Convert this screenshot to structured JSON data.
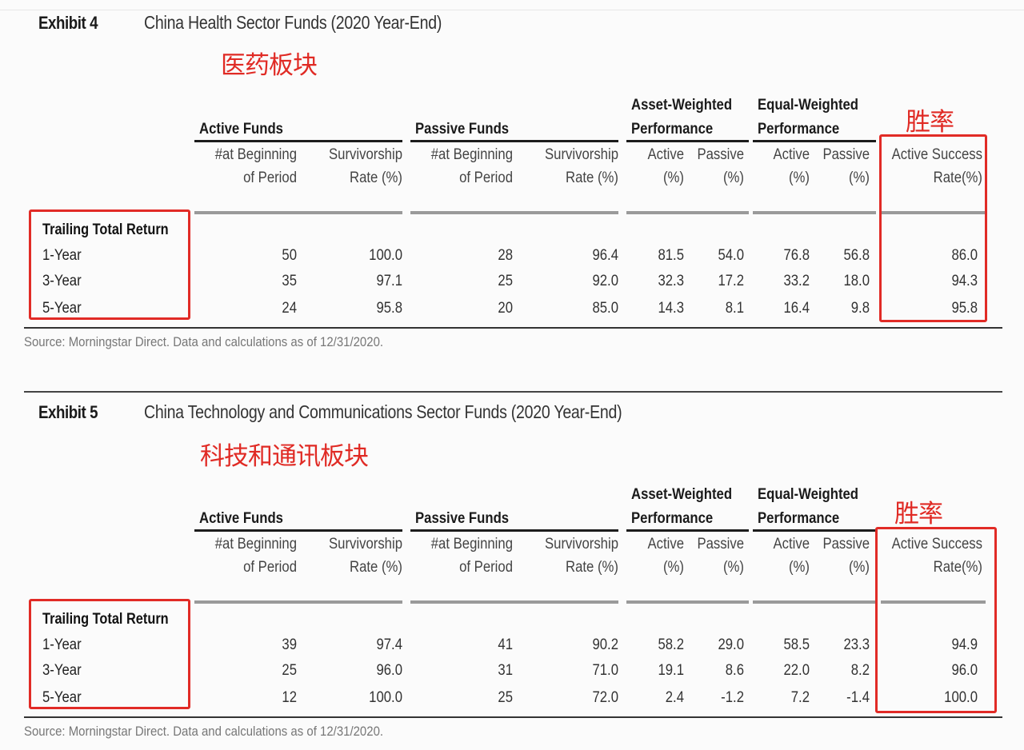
{
  "exhibits": [
    {
      "number": "Exhibit 4",
      "title": "China Health Sector Funds (2020 Year-End)",
      "annotation": "医药板块",
      "win_rate_annotation": "胜率",
      "groups": {
        "active_funds": "Active Funds",
        "passive_funds": "Passive Funds",
        "asset_weighted": [
          "Asset-Weighted",
          "Performance"
        ],
        "equal_weighted": [
          "Equal-Weighted",
          "Performance"
        ]
      },
      "columns": [
        [
          "#at Beginning",
          "of Period"
        ],
        [
          "Survivorship",
          "Rate (%)"
        ],
        [
          "#at Beginning",
          "of Period"
        ],
        [
          "Survivorship",
          "Rate (%)"
        ],
        [
          "Active",
          "(%)"
        ],
        [
          "Passive",
          "(%)"
        ],
        [
          "Active",
          "(%)"
        ],
        [
          "Passive",
          "(%)"
        ],
        [
          "Active Success",
          "Rate(%)"
        ]
      ],
      "row_header": "Trailing Total Return",
      "rows": [
        {
          "label": "1-Year",
          "values": [
            "50",
            "100.0",
            "28",
            "96.4",
            "81.5",
            "54.0",
            "76.8",
            "56.8",
            "86.0"
          ]
        },
        {
          "label": "3-Year",
          "values": [
            "35",
            "97.1",
            "25",
            "92.0",
            "32.3",
            "17.2",
            "33.2",
            "18.0",
            "94.3"
          ]
        },
        {
          "label": "5-Year",
          "values": [
            "24",
            "95.8",
            "20",
            "85.0",
            "14.3",
            "8.1",
            "16.4",
            "9.8",
            "95.8"
          ]
        }
      ],
      "source": "Source: Morningstar Direct. Data and calculations as of 12/31/2020."
    },
    {
      "number": "Exhibit 5",
      "title": "China Technology and Communications Sector Funds (2020 Year-End)",
      "annotation": "科技和通讯板块",
      "win_rate_annotation": "胜率",
      "groups": {
        "active_funds": "Active Funds",
        "passive_funds": "Passive Funds",
        "asset_weighted": [
          "Asset-Weighted",
          "Performance"
        ],
        "equal_weighted": [
          "Equal-Weighted",
          "Performance"
        ]
      },
      "columns": [
        [
          "#at Beginning",
          "of Period"
        ],
        [
          "Survivorship",
          "Rate (%)"
        ],
        [
          "#at Beginning",
          "of Period"
        ],
        [
          "Survivorship",
          "Rate (%)"
        ],
        [
          "Active",
          "(%)"
        ],
        [
          "Passive",
          "(%)"
        ],
        [
          "Active",
          "(%)"
        ],
        [
          "Passive",
          "(%)"
        ],
        [
          "Active Success",
          "Rate(%)"
        ]
      ],
      "row_header": "Trailing Total Return",
      "rows": [
        {
          "label": "1-Year",
          "values": [
            "39",
            "97.4",
            "41",
            "90.2",
            "58.2",
            "29.0",
            "58.5",
            "23.3",
            "94.9"
          ]
        },
        {
          "label": "3-Year",
          "values": [
            "25",
            "96.0",
            "31",
            "71.0",
            "19.1",
            "8.6",
            "22.0",
            "8.2",
            "96.0"
          ]
        },
        {
          "label": "5-Year",
          "values": [
            "12",
            "100.0",
            "25",
            "72.0",
            "2.4",
            "-1.2",
            "7.2",
            "-1.4",
            "100.0"
          ]
        }
      ],
      "source": "Source: Morningstar Direct. Data and calculations as of 12/31/2020."
    }
  ],
  "colors": {
    "annotation_red": "#e02a24",
    "text_dark": "#1a1a1a",
    "rule_gray": "#9a9a9a"
  }
}
